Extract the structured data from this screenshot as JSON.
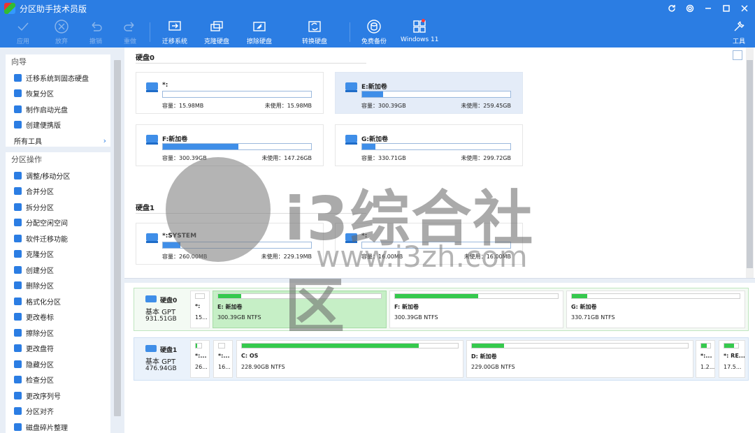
{
  "app": {
    "title": "分区助手技术员版"
  },
  "toolbar": {
    "items": [
      {
        "label": "应用",
        "icon": "check-icon",
        "disabled": true
      },
      {
        "label": "放弃",
        "icon": "cancel-icon",
        "disabled": true
      },
      {
        "label": "撤销",
        "icon": "undo-icon",
        "disabled": true
      },
      {
        "label": "重做",
        "icon": "redo-icon",
        "disabled": true
      },
      {
        "label": "迁移系统",
        "icon": "migrate-os-icon",
        "disabled": false
      },
      {
        "label": "克隆硬盘",
        "icon": "clone-disk-icon",
        "disabled": false
      },
      {
        "label": "擦除硬盘",
        "icon": "wipe-disk-icon",
        "disabled": false
      },
      {
        "label": "转换硬盘",
        "icon": "convert-disk-icon",
        "disabled": false
      },
      {
        "label": "免费备份",
        "icon": "backup-icon",
        "disabled": false
      },
      {
        "label": "Windows 11",
        "icon": "windows-icon",
        "disabled": false
      },
      {
        "label": "工具",
        "icon": "tools-icon",
        "disabled": false
      }
    ]
  },
  "sidebar": {
    "guide_title": "向导",
    "guide_items": [
      "迁移系统到固态硬盘",
      "恢复分区",
      "制作启动光盘",
      "创建便携版",
      "所有工具"
    ],
    "ops_title": "分区操作",
    "ops_items": [
      "调整/移动分区",
      "合并分区",
      "拆分分区",
      "分配空闲空间",
      "软件迁移功能",
      "克隆分区",
      "创建分区",
      "删除分区",
      "格式化分区",
      "更改卷标",
      "擦除分区",
      "更改盘符",
      "隐藏分区",
      "检查分区",
      "更改序列号",
      "分区对齐",
      "磁盘碎片整理"
    ]
  },
  "main": {
    "disk0": {
      "header": "硬盘0",
      "cards": [
        {
          "name": "*:",
          "used_fraction": 0.0,
          "capacity": "容量：15.98MB",
          "free": "未使用：15.98MB"
        },
        {
          "name": "E:新加卷",
          "used_fraction": 0.14,
          "capacity": "容量：300.39GB",
          "free": "未使用：259.45GB",
          "selected": true
        },
        {
          "name": "F:新加卷",
          "used_fraction": 0.51,
          "capacity": "容量：300.39GB",
          "free": "未使用：147.26GB"
        },
        {
          "name": "G:新加卷",
          "used_fraction": 0.09,
          "capacity": "容量：330.71GB",
          "free": "未使用：299.72GB"
        }
      ]
    },
    "disk1": {
      "header": "硬盘1",
      "cards": [
        {
          "name": "*:SYSTEM",
          "used_fraction": 0.12,
          "capacity": "容量：260.00MB",
          "free": "未使用：229.19MB"
        },
        {
          "name": "*:",
          "used_fraction": 0.0,
          "capacity": "容量：16.00MB",
          "free": "未使用：16.00MB"
        }
      ]
    }
  },
  "diskmap": {
    "disk0": {
      "name": "硬盘0",
      "type": "基本 GPT",
      "size": "931.51GB",
      "parts": [
        {
          "name": "*:",
          "info": "15...",
          "used_fraction": 0.0
        },
        {
          "name": "E: 新加卷",
          "info": "300.39GB NTFS",
          "used_fraction": 0.14,
          "selected": true
        },
        {
          "name": "F: 新加卷",
          "info": "300.39GB NTFS",
          "used_fraction": 0.51
        },
        {
          "name": "G: 新加卷",
          "info": "330.71GB NTFS",
          "used_fraction": 0.09
        }
      ]
    },
    "disk1": {
      "name": "硬盘1",
      "type": "基本 GPT",
      "size": "476.94GB",
      "parts": [
        {
          "name": "*:...",
          "info": "26...",
          "used_fraction": 0.2
        },
        {
          "name": "*:...",
          "info": "16...",
          "used_fraction": 0.0
        },
        {
          "name": "C: OS",
          "info": "228.90GB NTFS",
          "used_fraction": 0.82
        },
        {
          "name": "D: 新加卷",
          "info": "229.00GB NTFS",
          "used_fraction": 0.15
        },
        {
          "name": "*:...",
          "info": "1.2...",
          "used_fraction": 0.6
        },
        {
          "name": "*: RE...",
          "info": "17.5...",
          "used_fraction": 0.7
        }
      ]
    }
  },
  "watermark": {
    "text": "i3综合社区",
    "url": "www.i3zh.com"
  },
  "colors": {
    "accent": "#2b7de3",
    "bar_blue": "#3f8ee8",
    "bar_green": "#35c94d"
  }
}
